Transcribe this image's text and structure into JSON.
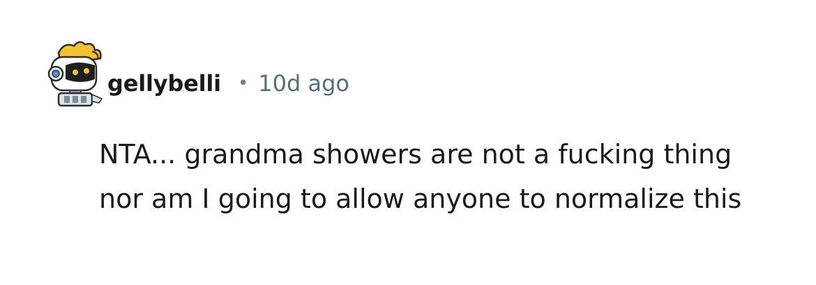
{
  "comment": {
    "author": "gellybelli",
    "separator": "•",
    "age": "10d ago",
    "avatar_icon": "robot-avatar-icon",
    "lines": [
      "NTA... grandma showers are not a fucking thing",
      "nor am I going to allow anyone to normalize this"
    ]
  },
  "colors": {
    "username": "#1a1a1b",
    "metadata": "#576f76",
    "body": "#1a1a1b",
    "avatar_hair": "#f2c230",
    "avatar_body": "#d9e3ea"
  }
}
